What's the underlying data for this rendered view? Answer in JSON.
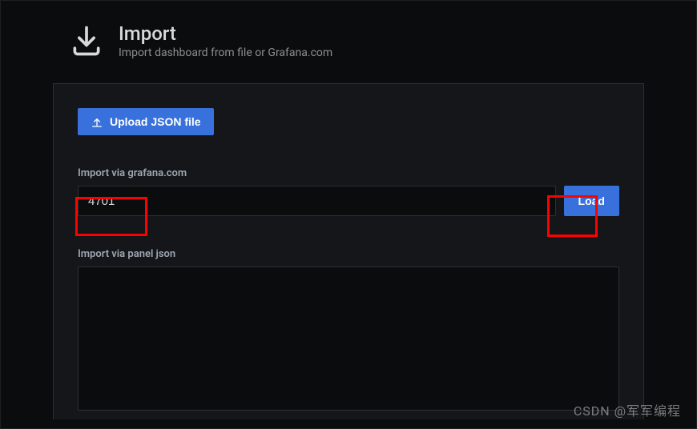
{
  "header": {
    "title": "Import",
    "subtitle": "Import dashboard from file or Grafana.com"
  },
  "upload": {
    "button_label": "Upload JSON file"
  },
  "grafana_import": {
    "label": "Import via grafana.com",
    "value": "4701",
    "load_label": "Load"
  },
  "panel_json": {
    "label": "Import via panel json",
    "value": ""
  },
  "watermark": "CSDN @军军编程"
}
